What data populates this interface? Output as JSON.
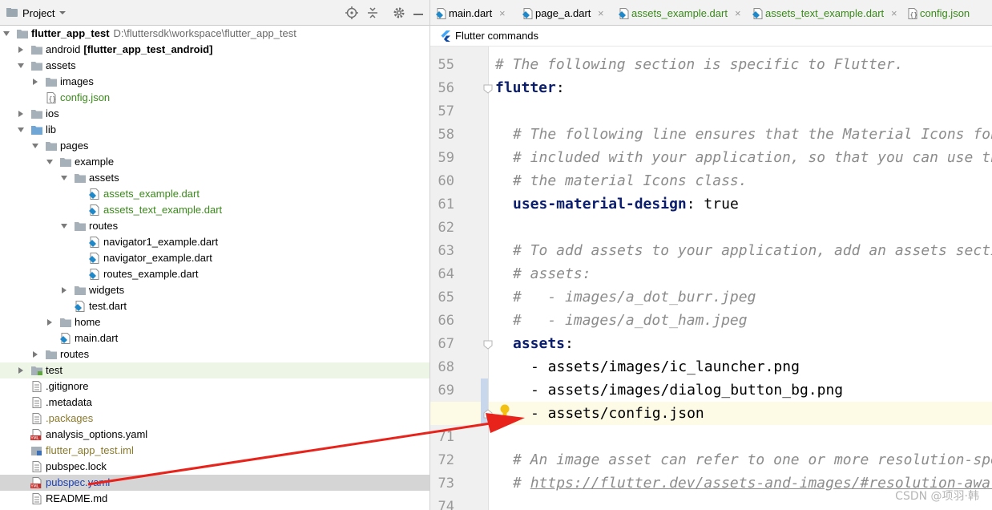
{
  "project_panel": {
    "title": "Project",
    "tree": [
      {
        "label": "flutter_app_test",
        "path": "D:\\fluttersdk\\workspace\\flutter_app_test",
        "indent": 0,
        "state": "expanded",
        "icon": "folder-icon",
        "style": "bold"
      },
      {
        "label": "android",
        "suffix": "[flutter_app_test_android]",
        "indent": 1,
        "state": "collapsed",
        "icon": "folder-icon"
      },
      {
        "label": "assets",
        "indent": 1,
        "state": "expanded",
        "icon": "folder-icon"
      },
      {
        "label": "images",
        "indent": 2,
        "state": "collapsed",
        "icon": "folder-icon"
      },
      {
        "label": "config.json",
        "indent": 2,
        "state": "leaf",
        "icon": "json-file-icon",
        "color": "#3a8a1a"
      },
      {
        "label": "ios",
        "indent": 1,
        "state": "collapsed",
        "icon": "folder-icon"
      },
      {
        "label": "lib",
        "indent": 1,
        "state": "expanded",
        "icon": "source-folder-icon"
      },
      {
        "label": "pages",
        "indent": 2,
        "state": "expanded",
        "icon": "folder-icon"
      },
      {
        "label": "example",
        "indent": 3,
        "state": "expanded",
        "icon": "folder-icon"
      },
      {
        "label": "assets",
        "indent": 4,
        "state": "expanded",
        "icon": "folder-icon"
      },
      {
        "label": "assets_example.dart",
        "indent": 5,
        "state": "leaf",
        "icon": "dart-file-icon",
        "color": "#3a8a1a"
      },
      {
        "label": "assets_text_example.dart",
        "indent": 5,
        "state": "leaf",
        "icon": "dart-file-icon",
        "color": "#3a8a1a"
      },
      {
        "label": "routes",
        "indent": 4,
        "state": "expanded",
        "icon": "folder-icon"
      },
      {
        "label": "navigator1_example.dart",
        "indent": 5,
        "state": "leaf",
        "icon": "dart-file-icon"
      },
      {
        "label": "navigator_example.dart",
        "indent": 5,
        "state": "leaf",
        "icon": "dart-file-icon"
      },
      {
        "label": "routes_example.dart",
        "indent": 5,
        "state": "leaf",
        "icon": "dart-file-icon"
      },
      {
        "label": "widgets",
        "indent": 4,
        "state": "collapsed",
        "icon": "folder-icon"
      },
      {
        "label": "test.dart",
        "indent": 4,
        "state": "leaf",
        "icon": "dart-file-icon"
      },
      {
        "label": "home",
        "indent": 3,
        "state": "collapsed",
        "icon": "folder-icon"
      },
      {
        "label": "main.dart",
        "indent": 3,
        "state": "leaf",
        "icon": "dart-file-icon"
      },
      {
        "label": "routes",
        "indent": 2,
        "state": "collapsed",
        "icon": "folder-icon"
      },
      {
        "label": "test",
        "indent": 1,
        "state": "collapsed",
        "icon": "test-folder-icon",
        "highlight": "green"
      },
      {
        "label": ".gitignore",
        "indent": 1,
        "state": "leaf",
        "icon": "text-file-icon"
      },
      {
        "label": ".metadata",
        "indent": 1,
        "state": "leaf",
        "icon": "text-file-icon"
      },
      {
        "label": ".packages",
        "indent": 1,
        "state": "leaf",
        "icon": "text-file-icon",
        "color": "#8a7a2a"
      },
      {
        "label": "analysis_options.yaml",
        "indent": 1,
        "state": "leaf",
        "icon": "yaml-file-icon"
      },
      {
        "label": "flutter_app_test.iml",
        "indent": 1,
        "state": "leaf",
        "icon": "module-file-icon",
        "color": "#8a7a2a"
      },
      {
        "label": "pubspec.lock",
        "indent": 1,
        "state": "leaf",
        "icon": "text-file-icon"
      },
      {
        "label": "pubspec.yaml",
        "indent": 1,
        "state": "leaf",
        "icon": "yaml-file-icon",
        "color": "#1a3fb0",
        "selected": true
      },
      {
        "label": "README.md",
        "indent": 1,
        "state": "leaf",
        "icon": "text-file-icon"
      }
    ]
  },
  "editor": {
    "tabs": [
      {
        "label": "main.dart",
        "color": "#000000"
      },
      {
        "label": "page_a.dart",
        "color": "#000000"
      },
      {
        "label": "assets_example.dart",
        "color": "#3a8a1a"
      },
      {
        "label": "assets_text_example.dart",
        "color": "#3a8a1a"
      },
      {
        "label": "config.json",
        "color": "#3a8a1a"
      }
    ],
    "breadcrumb": "Flutter commands",
    "lines": [
      {
        "num": "55",
        "indent": 0,
        "text": "# The following section is specific to Flutter.",
        "kind": "comment"
      },
      {
        "num": "56",
        "indent": 0,
        "key": "flutter",
        "value": "",
        "kind": "key"
      },
      {
        "num": "57",
        "indent": 0,
        "text": "",
        "kind": "blank"
      },
      {
        "num": "58",
        "indent": 1,
        "text": "# The following line ensures that the Material Icons font is",
        "kind": "comment"
      },
      {
        "num": "59",
        "indent": 1,
        "text": "# included with your application, so that you can use the icons in",
        "kind": "comment"
      },
      {
        "num": "60",
        "indent": 1,
        "text": "# the material Icons class.",
        "kind": "comment"
      },
      {
        "num": "61",
        "indent": 1,
        "key": "uses-material-design",
        "value": " true",
        "kind": "key"
      },
      {
        "num": "62",
        "indent": 0,
        "text": "",
        "kind": "blank"
      },
      {
        "num": "63",
        "indent": 1,
        "text": "# To add assets to your application, add an assets section, like this:",
        "kind": "comment"
      },
      {
        "num": "64",
        "indent": 1,
        "text": "# assets:",
        "kind": "comment"
      },
      {
        "num": "65",
        "indent": 1,
        "text": "#   - images/a_dot_burr.jpeg",
        "kind": "comment"
      },
      {
        "num": "66",
        "indent": 1,
        "text": "#   - images/a_dot_ham.jpeg",
        "kind": "comment"
      },
      {
        "num": "67",
        "indent": 1,
        "key": "assets",
        "value": "",
        "kind": "key"
      },
      {
        "num": "68",
        "indent": 2,
        "text": "- assets/images/ic_launcher.png",
        "kind": "plain"
      },
      {
        "num": "69",
        "indent": 2,
        "text": "- assets/images/dialog_button_bg.png",
        "kind": "plain"
      },
      {
        "num": "70",
        "indent": 2,
        "text": "- assets/config.json",
        "kind": "plain"
      },
      {
        "num": "71",
        "indent": 0,
        "text": "",
        "kind": "blank"
      },
      {
        "num": "72",
        "indent": 1,
        "text": "# An image asset can refer to one or more resolution-specific \"variants\", see",
        "kind": "comment"
      },
      {
        "num": "73",
        "indent": 1,
        "text": "# ",
        "link": "https://flutter.dev/assets-and-images/#resolution-aware.",
        "kind": "comment-link"
      },
      {
        "num": "74",
        "indent": 0,
        "text": "",
        "kind": "blank"
      }
    ]
  },
  "watermark": "CSDN @项羽·韩",
  "colors": {
    "selection": "#d5d5d5",
    "caret_line": "#fdfbe5",
    "arrow": "#e8231b",
    "yaml_key": "#0b1e6e",
    "comment": "#8c8c8c"
  }
}
